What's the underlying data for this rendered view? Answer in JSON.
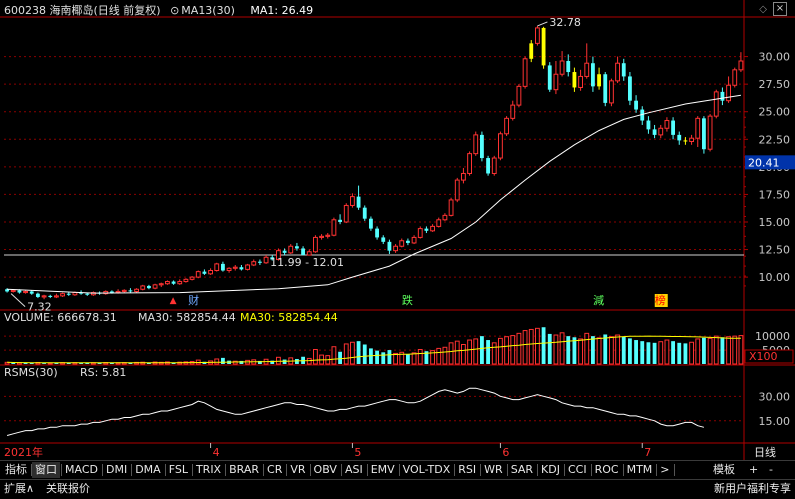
{
  "header": {
    "stock": "600238 海南椰岛(日线 前复权)",
    "ma_label": "MA13(30)",
    "ma_value": "MA1: 26.49"
  },
  "price_axis": {
    "ticks": [
      "30.00",
      "27.50",
      "25.00",
      "22.50",
      "20.00",
      "17.50",
      "15.00",
      "12.50",
      "10.00"
    ],
    "ylim": [
      7.2,
      33.5
    ],
    "current": "20.41"
  },
  "chart_data": {
    "type": "candlestick",
    "x_labels": [
      "2021年",
      "4",
      "5",
      "6",
      "7"
    ],
    "ohlc": [
      [
        8.9,
        8.7,
        9.0,
        8.6
      ],
      [
        8.7,
        8.8,
        8.9,
        8.6
      ],
      [
        8.8,
        8.6,
        8.9,
        8.5
      ],
      [
        8.6,
        8.7,
        8.8,
        8.5
      ],
      [
        8.7,
        8.5,
        8.8,
        8.4
      ],
      [
        8.5,
        8.2,
        8.6,
        8.1
      ],
      [
        8.2,
        8.3,
        8.4,
        8.0
      ],
      [
        8.3,
        8.2,
        8.4,
        8.1
      ],
      [
        8.2,
        8.3,
        8.5,
        8.1
      ],
      [
        8.3,
        8.5,
        8.6,
        8.2
      ],
      [
        8.5,
        8.4,
        8.6,
        8.3
      ],
      [
        8.4,
        8.6,
        8.7,
        8.3
      ],
      [
        8.6,
        8.5,
        8.8,
        8.4
      ],
      [
        8.5,
        8.4,
        8.6,
        8.3
      ],
      [
        8.4,
        8.6,
        8.7,
        8.3
      ],
      [
        8.6,
        8.5,
        8.7,
        8.4
      ],
      [
        8.5,
        8.7,
        8.8,
        8.4
      ],
      [
        8.7,
        8.6,
        8.8,
        8.5
      ],
      [
        8.6,
        8.7,
        8.9,
        8.5
      ],
      [
        8.7,
        8.8,
        8.9,
        8.6
      ],
      [
        8.8,
        8.7,
        9.0,
        8.6
      ],
      [
        8.7,
        8.9,
        9.0,
        8.6
      ],
      [
        8.9,
        9.2,
        9.3,
        8.8
      ],
      [
        9.2,
        9.0,
        9.3,
        8.9
      ],
      [
        9.0,
        9.3,
        9.4,
        8.9
      ],
      [
        9.3,
        9.4,
        9.5,
        9.1
      ],
      [
        9.4,
        9.6,
        9.7,
        9.3
      ],
      [
        9.6,
        9.4,
        9.7,
        9.3
      ],
      [
        9.4,
        9.6,
        9.8,
        9.3
      ],
      [
        9.6,
        9.8,
        9.9,
        9.5
      ],
      [
        9.8,
        10.0,
        10.1,
        9.7
      ],
      [
        10.0,
        10.5,
        10.6,
        9.9
      ],
      [
        10.5,
        10.3,
        10.7,
        10.2
      ],
      [
        10.3,
        10.6,
        10.8,
        10.2
      ],
      [
        10.6,
        11.2,
        11.3,
        10.5
      ],
      [
        11.2,
        10.6,
        11.4,
        10.5
      ],
      [
        10.6,
        10.8,
        10.9,
        10.4
      ],
      [
        10.8,
        10.9,
        11.1,
        10.6
      ],
      [
        10.9,
        10.7,
        11.1,
        10.6
      ],
      [
        10.7,
        11.1,
        11.2,
        10.6
      ],
      [
        11.1,
        11.4,
        11.6,
        11.0
      ],
      [
        11.4,
        11.3,
        11.6,
        11.1
      ],
      [
        11.3,
        11.8,
        12.0,
        11.2
      ],
      [
        11.8,
        11.6,
        12.0,
        11.5
      ],
      [
        11.6,
        12.4,
        12.6,
        11.5
      ],
      [
        12.4,
        12.2,
        12.6,
        12.0
      ],
      [
        12.2,
        12.8,
        13.0,
        12.1
      ],
      [
        12.8,
        12.6,
        13.1,
        12.4
      ],
      [
        12.6,
        12.0,
        12.8,
        11.99
      ],
      [
        12.0,
        12.3,
        12.5,
        11.99
      ],
      [
        12.3,
        13.6,
        13.8,
        12.2
      ],
      [
        13.6,
        13.7,
        13.9,
        13.4
      ],
      [
        13.7,
        13.8,
        14.0,
        13.5
      ],
      [
        13.8,
        15.2,
        15.4,
        13.7
      ],
      [
        15.2,
        15.0,
        15.7,
        14.8
      ],
      [
        15.0,
        16.5,
        16.7,
        14.9
      ],
      [
        16.5,
        17.3,
        17.6,
        16.3
      ],
      [
        17.3,
        16.3,
        18.3,
        16.1
      ],
      [
        16.3,
        15.3,
        16.5,
        15.1
      ],
      [
        15.3,
        14.4,
        15.5,
        14.2
      ],
      [
        14.4,
        13.6,
        14.6,
        13.4
      ],
      [
        13.6,
        13.2,
        13.8,
        13.0
      ],
      [
        13.2,
        12.4,
        13.4,
        12.1
      ],
      [
        12.4,
        12.8,
        13.0,
        12.2
      ],
      [
        12.8,
        13.3,
        13.5,
        12.7
      ],
      [
        13.3,
        13.1,
        13.5,
        12.9
      ],
      [
        13.1,
        13.6,
        13.8,
        13.0
      ],
      [
        13.6,
        14.4,
        14.6,
        13.5
      ],
      [
        14.4,
        14.2,
        14.6,
        14.0
      ],
      [
        14.2,
        14.6,
        14.8,
        14.1
      ],
      [
        14.6,
        15.2,
        15.4,
        14.5
      ],
      [
        15.2,
        15.6,
        15.8,
        15.1
      ],
      [
        15.6,
        17.0,
        17.2,
        15.5
      ],
      [
        17.0,
        18.8,
        19.0,
        16.8
      ],
      [
        18.8,
        19.4,
        19.9,
        18.5
      ],
      [
        19.4,
        21.2,
        21.4,
        19.2
      ],
      [
        21.2,
        22.9,
        23.2,
        21.0
      ],
      [
        22.9,
        20.8,
        23.2,
        20.5
      ],
      [
        20.8,
        19.4,
        21.0,
        19.2
      ],
      [
        19.4,
        20.8,
        21.0,
        19.2
      ],
      [
        20.8,
        23.0,
        23.2,
        20.6
      ],
      [
        23.0,
        24.4,
        24.6,
        22.8
      ],
      [
        24.4,
        25.6,
        26.0,
        24.2
      ],
      [
        25.6,
        27.3,
        27.5,
        25.4
      ],
      [
        27.3,
        29.8,
        30.0,
        27.1
      ],
      [
        29.8,
        31.2,
        31.5,
        29.5
      ],
      [
        31.2,
        32.6,
        32.78,
        31.0
      ],
      [
        32.6,
        29.2,
        32.7,
        28.9
      ],
      [
        29.2,
        27.0,
        29.5,
        26.8
      ],
      [
        27.0,
        28.4,
        29.6,
        26.6
      ],
      [
        28.4,
        29.6,
        30.5,
        28.2
      ],
      [
        29.6,
        28.6,
        30.2,
        28.2
      ],
      [
        28.6,
        27.2,
        29.0,
        26.8
      ],
      [
        27.2,
        28.2,
        28.8,
        26.9
      ],
      [
        28.2,
        29.4,
        31.2,
        28.0
      ],
      [
        29.4,
        27.3,
        30.0,
        26.8
      ],
      [
        27.3,
        28.4,
        29.0,
        27.0
      ],
      [
        28.4,
        25.8,
        28.6,
        25.5
      ],
      [
        25.8,
        27.8,
        28.0,
        25.5
      ],
      [
        27.8,
        29.4,
        30.0,
        27.6
      ],
      [
        29.4,
        28.2,
        29.8,
        27.8
      ],
      [
        28.2,
        26.0,
        28.6,
        25.6
      ],
      [
        26.0,
        25.2,
        26.5,
        24.9
      ],
      [
        25.2,
        24.2,
        25.5,
        23.8
      ],
      [
        24.2,
        23.4,
        24.6,
        23.0
      ],
      [
        23.4,
        22.9,
        23.8,
        22.6
      ],
      [
        22.9,
        23.5,
        23.8,
        22.6
      ],
      [
        23.5,
        24.2,
        24.5,
        23.2
      ],
      [
        24.2,
        22.9,
        24.5,
        22.5
      ],
      [
        22.9,
        22.4,
        23.2,
        22.0
      ],
      [
        22.4,
        22.3,
        22.7,
        22.0
      ],
      [
        22.3,
        22.6,
        22.9,
        22.0
      ],
      [
        22.6,
        24.4,
        24.6,
        21.8
      ],
      [
        24.4,
        21.6,
        24.6,
        21.2
      ],
      [
        21.6,
        24.6,
        24.8,
        21.4
      ],
      [
        24.6,
        26.8,
        27.0,
        24.4
      ],
      [
        26.8,
        26.0,
        27.2,
        25.6
      ],
      [
        26.0,
        27.4,
        28.2,
        25.8
      ],
      [
        27.4,
        28.8,
        29.0,
        27.2
      ],
      [
        28.8,
        29.6,
        30.4,
        28.6
      ]
    ],
    "volume": [
      [
        60,
        "r"
      ],
      [
        45,
        "c"
      ],
      [
        50,
        "r"
      ],
      [
        40,
        "c"
      ],
      [
        35,
        "c"
      ],
      [
        55,
        "r"
      ],
      [
        30,
        "c"
      ],
      [
        38,
        "r"
      ],
      [
        42,
        "c"
      ],
      [
        50,
        "r"
      ],
      [
        36,
        "c"
      ],
      [
        48,
        "r"
      ],
      [
        33,
        "c"
      ],
      [
        40,
        "c"
      ],
      [
        46,
        "r"
      ],
      [
        34,
        "c"
      ],
      [
        52,
        "r"
      ],
      [
        38,
        "c"
      ],
      [
        44,
        "r"
      ],
      [
        50,
        "r"
      ],
      [
        36,
        "c"
      ],
      [
        58,
        "r"
      ],
      [
        64,
        "r"
      ],
      [
        40,
        "c"
      ],
      [
        70,
        "r"
      ],
      [
        60,
        "r"
      ],
      [
        74,
        "r"
      ],
      [
        45,
        "c"
      ],
      [
        66,
        "r"
      ],
      [
        78,
        "r"
      ],
      [
        90,
        "r"
      ],
      [
        140,
        "r"
      ],
      [
        80,
        "c"
      ],
      [
        110,
        "r"
      ],
      [
        180,
        "r"
      ],
      [
        220,
        "c"
      ],
      [
        120,
        "c"
      ],
      [
        100,
        "r"
      ],
      [
        110,
        "c"
      ],
      [
        130,
        "r"
      ],
      [
        150,
        "r"
      ],
      [
        110,
        "c"
      ],
      [
        170,
        "r"
      ],
      [
        120,
        "c"
      ],
      [
        240,
        "r"
      ],
      [
        160,
        "c"
      ],
      [
        220,
        "r"
      ],
      [
        180,
        "c"
      ],
      [
        260,
        "c"
      ],
      [
        200,
        "r"
      ],
      [
        520,
        "r"
      ],
      [
        320,
        "r"
      ],
      [
        300,
        "r"
      ],
      [
        620,
        "r"
      ],
      [
        440,
        "c"
      ],
      [
        720,
        "r"
      ],
      [
        780,
        "r"
      ],
      [
        820,
        "c"
      ],
      [
        700,
        "c"
      ],
      [
        560,
        "c"
      ],
      [
        480,
        "c"
      ],
      [
        420,
        "c"
      ],
      [
        500,
        "c"
      ],
      [
        380,
        "r"
      ],
      [
        420,
        "r"
      ],
      [
        340,
        "c"
      ],
      [
        400,
        "r"
      ],
      [
        520,
        "r"
      ],
      [
        460,
        "c"
      ],
      [
        480,
        "r"
      ],
      [
        560,
        "r"
      ],
      [
        600,
        "r"
      ],
      [
        760,
        "r"
      ],
      [
        820,
        "r"
      ],
      [
        700,
        "r"
      ],
      [
        860,
        "r"
      ],
      [
        900,
        "r"
      ],
      [
        1000,
        "c"
      ],
      [
        860,
        "c"
      ],
      [
        760,
        "r"
      ],
      [
        920,
        "r"
      ],
      [
        980,
        "r"
      ],
      [
        1020,
        "r"
      ],
      [
        1100,
        "r"
      ],
      [
        1200,
        "r"
      ],
      [
        1240,
        "r"
      ],
      [
        1280,
        "r"
      ],
      [
        1320,
        "c"
      ],
      [
        1080,
        "c"
      ],
      [
        1040,
        "r"
      ],
      [
        1120,
        "r"
      ],
      [
        1000,
        "c"
      ],
      [
        960,
        "c"
      ],
      [
        900,
        "r"
      ],
      [
        1100,
        "r"
      ],
      [
        1000,
        "c"
      ],
      [
        940,
        "r"
      ],
      [
        1060,
        "c"
      ],
      [
        980,
        "r"
      ],
      [
        1040,
        "r"
      ],
      [
        980,
        "c"
      ],
      [
        920,
        "c"
      ],
      [
        860,
        "c"
      ],
      [
        820,
        "c"
      ],
      [
        780,
        "c"
      ],
      [
        760,
        "c"
      ],
      [
        800,
        "r"
      ],
      [
        860,
        "r"
      ],
      [
        820,
        "c"
      ],
      [
        760,
        "c"
      ],
      [
        740,
        "c"
      ],
      [
        780,
        "r"
      ],
      [
        900,
        "r"
      ],
      [
        940,
        "c"
      ],
      [
        920,
        "r"
      ],
      [
        1000,
        "r"
      ],
      [
        960,
        "c"
      ],
      [
        980,
        "r"
      ],
      [
        1000,
        "r"
      ],
      [
        1020,
        "r"
      ]
    ],
    "ma30_price": [
      [
        0,
        8.9
      ],
      [
        14,
        8.55
      ],
      [
        28,
        8.6
      ],
      [
        44,
        8.95
      ],
      [
        52,
        9.3
      ],
      [
        56,
        10.0
      ],
      [
        62,
        11.0
      ],
      [
        66,
        12.1
      ],
      [
        72,
        13.5
      ],
      [
        76,
        15.0
      ],
      [
        80,
        17.0
      ],
      [
        84,
        18.8
      ],
      [
        88,
        20.5
      ],
      [
        92,
        22.0
      ],
      [
        96,
        23.3
      ],
      [
        100,
        24.3
      ],
      [
        104,
        24.9
      ],
      [
        110,
        25.7
      ],
      [
        119,
        26.49
      ]
    ],
    "rsms": [
      6,
      7,
      8,
      9,
      9,
      10,
      10,
      11,
      11,
      12,
      12,
      12,
      13,
      13,
      14,
      14,
      15,
      16,
      16,
      17,
      17,
      18,
      19,
      19,
      20,
      21,
      21,
      22,
      23,
      24,
      25,
      27,
      26,
      24,
      22,
      21,
      20,
      19,
      19,
      20,
      21,
      22,
      23,
      24,
      25,
      26,
      26,
      25,
      25,
      24,
      23,
      22,
      21,
      21,
      22,
      22,
      23,
      24,
      24,
      25,
      26,
      27,
      28,
      28,
      27,
      26,
      26,
      27,
      29,
      31,
      33,
      34,
      33,
      32,
      33,
      35,
      35,
      34,
      33,
      32,
      30,
      29,
      28,
      28,
      29,
      30,
      31,
      30,
      29,
      28,
      26,
      25,
      24,
      24,
      23,
      23,
      22,
      21,
      20,
      19,
      19,
      18,
      18,
      17,
      16,
      15,
      13,
      12,
      12,
      13,
      14,
      14,
      12,
      11
    ],
    "rsms_ylim": [
      2,
      40
    ]
  },
  "annotations": {
    "high": "32.78",
    "low": "7.32",
    "range": "11.99 - 12.01",
    "events": [
      "财",
      "跌",
      "減",
      "榜"
    ]
  },
  "volume_panel": {
    "title": "VOLUME: 666678.31",
    "ma30": "MA30: 582854.44",
    "ma30b": "MA30: 582854.44",
    "ticks": [
      "10000",
      "5000"
    ],
    "unit": "X100"
  },
  "indicator_panel": {
    "title": "RSMS(30)",
    "value": "RS: 5.81",
    "ticks": [
      "30.00",
      "15.00"
    ]
  },
  "period_label": "日线",
  "tabs": [
    "指标",
    "窗口",
    "MACD",
    "DMI",
    "DMA",
    "FSL",
    "TRIX",
    "BRAR",
    "CR",
    "VR",
    "OBV",
    "ASI",
    "EMV",
    "VOL-TDX",
    "RSI",
    "WR",
    "SAR",
    "KDJ",
    "CCI",
    "ROC",
    "MTM",
    ">"
  ],
  "right_tabs": [
    "模板",
    "+",
    "-"
  ],
  "status": {
    "expand": "扩展∧",
    "related": "关联报价",
    "news": "新用户福利专享"
  },
  "colors": {
    "up": "#ff3232",
    "down": "#54ffff",
    "flat_up": "#ffff00",
    "ma": "#ffffff",
    "grid": "#8b0000",
    "axis": "#b00000",
    "yellow": "#ffff00"
  }
}
